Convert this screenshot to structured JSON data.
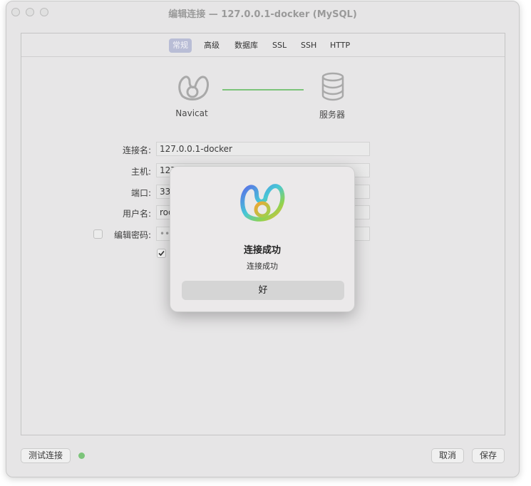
{
  "window": {
    "title": "编辑连接 — 127.0.0.1-docker (MySQL)"
  },
  "tabs": [
    {
      "label": "常规",
      "active": true
    },
    {
      "label": "高级",
      "active": false
    },
    {
      "label": "数据库",
      "active": false
    },
    {
      "label": "SSL",
      "active": false
    },
    {
      "label": "SSH",
      "active": false
    },
    {
      "label": "HTTP",
      "active": false
    }
  ],
  "diagram": {
    "left_label": "Navicat",
    "right_label": "服务器",
    "link_color": "#7cc47a"
  },
  "form": {
    "connection_name_label": "连接名:",
    "connection_name_value": "127.0.0.1-docker",
    "host_label": "主机:",
    "host_value": "127",
    "port_label": "端口:",
    "port_value": "33",
    "user_label": "用户名:",
    "user_value": "roo",
    "password_label": "编辑密码:",
    "password_value": "••",
    "edit_password_checked": false,
    "save_password_checked": true
  },
  "bottom": {
    "test_button": "测试连接",
    "status_color": "#7cc47a",
    "cancel_button": "取消",
    "save_button": "保存"
  },
  "dialog": {
    "title": "连接成功",
    "message": "连接成功",
    "ok_button": "好"
  }
}
